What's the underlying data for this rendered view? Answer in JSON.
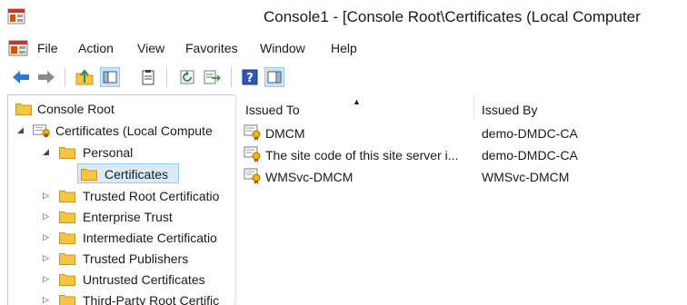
{
  "window": {
    "title": "Console1 - [Console Root\\Certificates (Local Computer"
  },
  "menu": {
    "items": [
      "File",
      "Action",
      "View",
      "Favorites",
      "Window",
      "Help"
    ]
  },
  "toolbar": {
    "buttons": [
      "back-arrow-icon",
      "forward-arrow-icon",
      "up-folder-icon",
      "show-hide-tree-icon",
      "clipboard-icon",
      "refresh-icon",
      "export-list-icon",
      "help-icon",
      "action-pane-icon"
    ]
  },
  "tree": {
    "root": "Console Root",
    "certificates_node": "Certificates (Local Compute",
    "personal": "Personal",
    "personal_certificates": "Certificates",
    "stores": [
      "Trusted Root Certificatio",
      "Enterprise Trust",
      "Intermediate Certificatio",
      "Trusted Publishers",
      "Untrusted Certificates",
      "Third-Party Root Certific"
    ]
  },
  "list": {
    "columns": {
      "issued_to": "Issued To",
      "issued_by": "Issued By"
    },
    "rows": [
      {
        "issued_to": "DMCM",
        "issued_by": "demo-DMDC-CA"
      },
      {
        "issued_to": "The site code of this site server i...",
        "issued_by": "demo-DMDC-CA"
      },
      {
        "issued_to": "WMSvc-DMCM",
        "issued_by": "WMSvc-DMCM"
      }
    ]
  },
  "colors": {
    "selection_fill": "#d9ebf9",
    "selection_border": "#9ccaf0",
    "folder": "#f5c542"
  }
}
